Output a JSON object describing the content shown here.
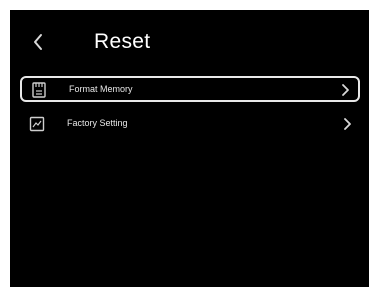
{
  "header": {
    "back_icon": "chevron-left-icon",
    "title": "Reset"
  },
  "menu": {
    "items": [
      {
        "label": "Format Memory",
        "icon": "memory-card-icon",
        "selected": true
      },
      {
        "label": "Factory Setting",
        "icon": "factory-setting-icon",
        "selected": false
      }
    ]
  },
  "colors": {
    "background": "#000000",
    "text": "#ffffff",
    "selection_border": "#e8e8e8"
  }
}
